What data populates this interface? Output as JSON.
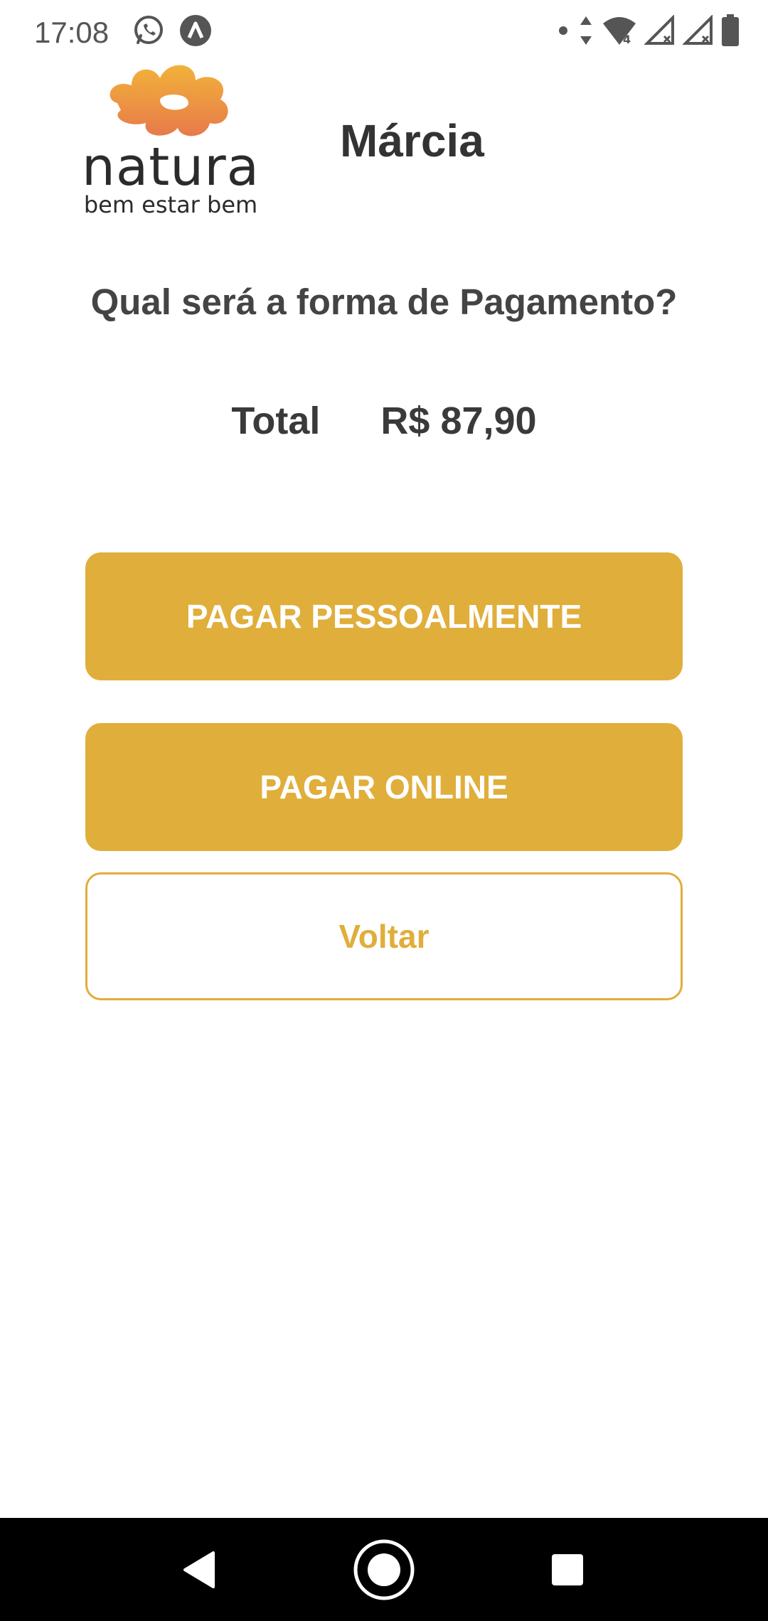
{
  "status_bar": {
    "time": "17:08",
    "left_icons": [
      "whatsapp-icon",
      "app-notification-icon"
    ],
    "right_icons": [
      "dot-icon",
      "data-arrows-icon",
      "wifi-icon",
      "signal-icon",
      "signal-icon",
      "battery-icon"
    ],
    "wifi_label": "4"
  },
  "header": {
    "logo_word": "natura",
    "logo_tagline": "bem estar bem",
    "user_name": "Márcia"
  },
  "main": {
    "question": "Qual será a forma de Pagamento?",
    "total_label": "Total",
    "total_value": "R$ 87,90",
    "buttons": {
      "pay_in_person": "PAGAR PESSOALMENTE",
      "pay_online": "PAGAR ONLINE",
      "back": "Voltar"
    }
  },
  "nav_bar": {
    "icons": [
      "back-triangle-icon",
      "home-circle-icon",
      "recents-square-icon"
    ]
  },
  "colors": {
    "accent": "#e0ae3b",
    "text_dark": "#333333",
    "nav_background": "#000000",
    "logo_orange": "#f0a23a"
  }
}
